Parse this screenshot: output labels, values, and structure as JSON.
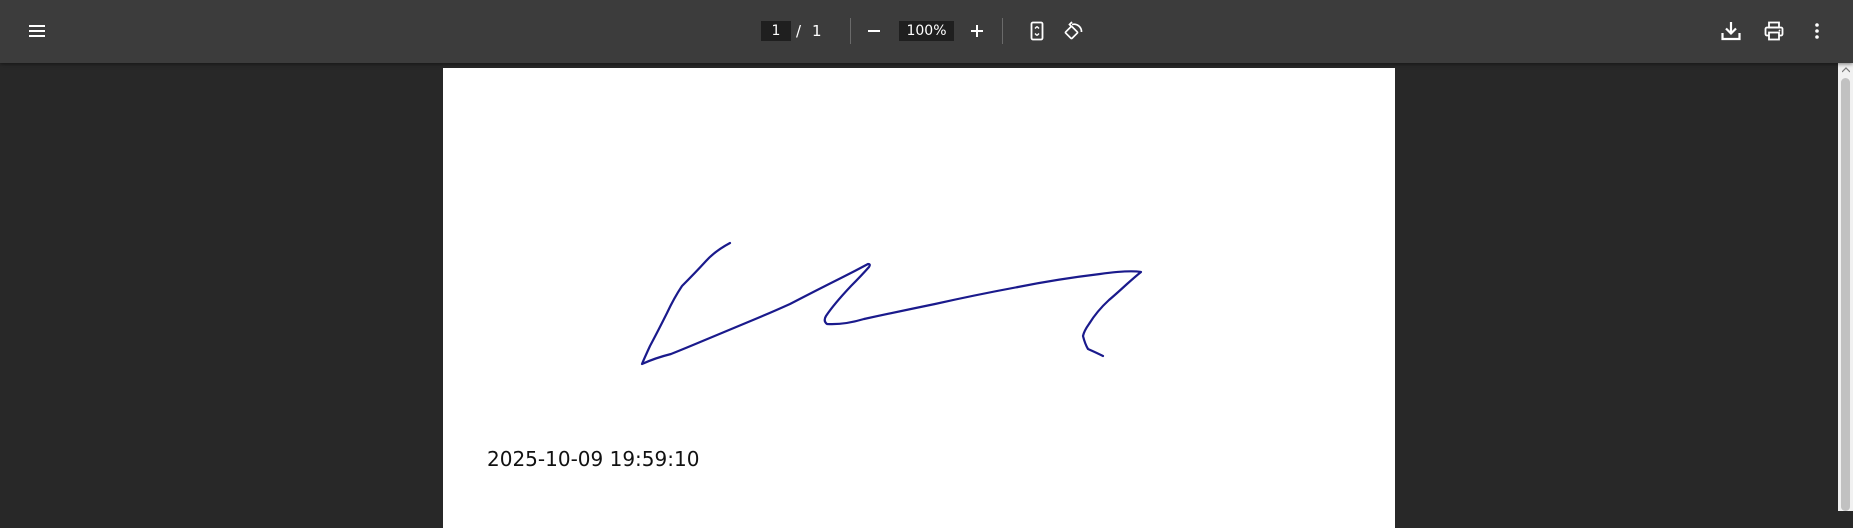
{
  "toolbar": {
    "menu_icon": "hamburger-menu-icon",
    "page_current": "1",
    "page_separator": "/",
    "page_total": "1",
    "zoom_out_icon": "minus-icon",
    "zoom_value": "100%",
    "zoom_in_icon": "plus-icon",
    "fit_icon": "fit-to-page-icon",
    "rotate_icon": "rotate-counterclockwise-icon",
    "download_icon": "download-icon",
    "print_icon": "print-icon",
    "more_icon": "more-vertical-icon",
    "background_color": "#3c3c3c"
  },
  "document": {
    "signature_ink_color": "#1a1a8c",
    "timestamp": "2025-10-09 19:59:10",
    "viewer_background": "#282828"
  }
}
